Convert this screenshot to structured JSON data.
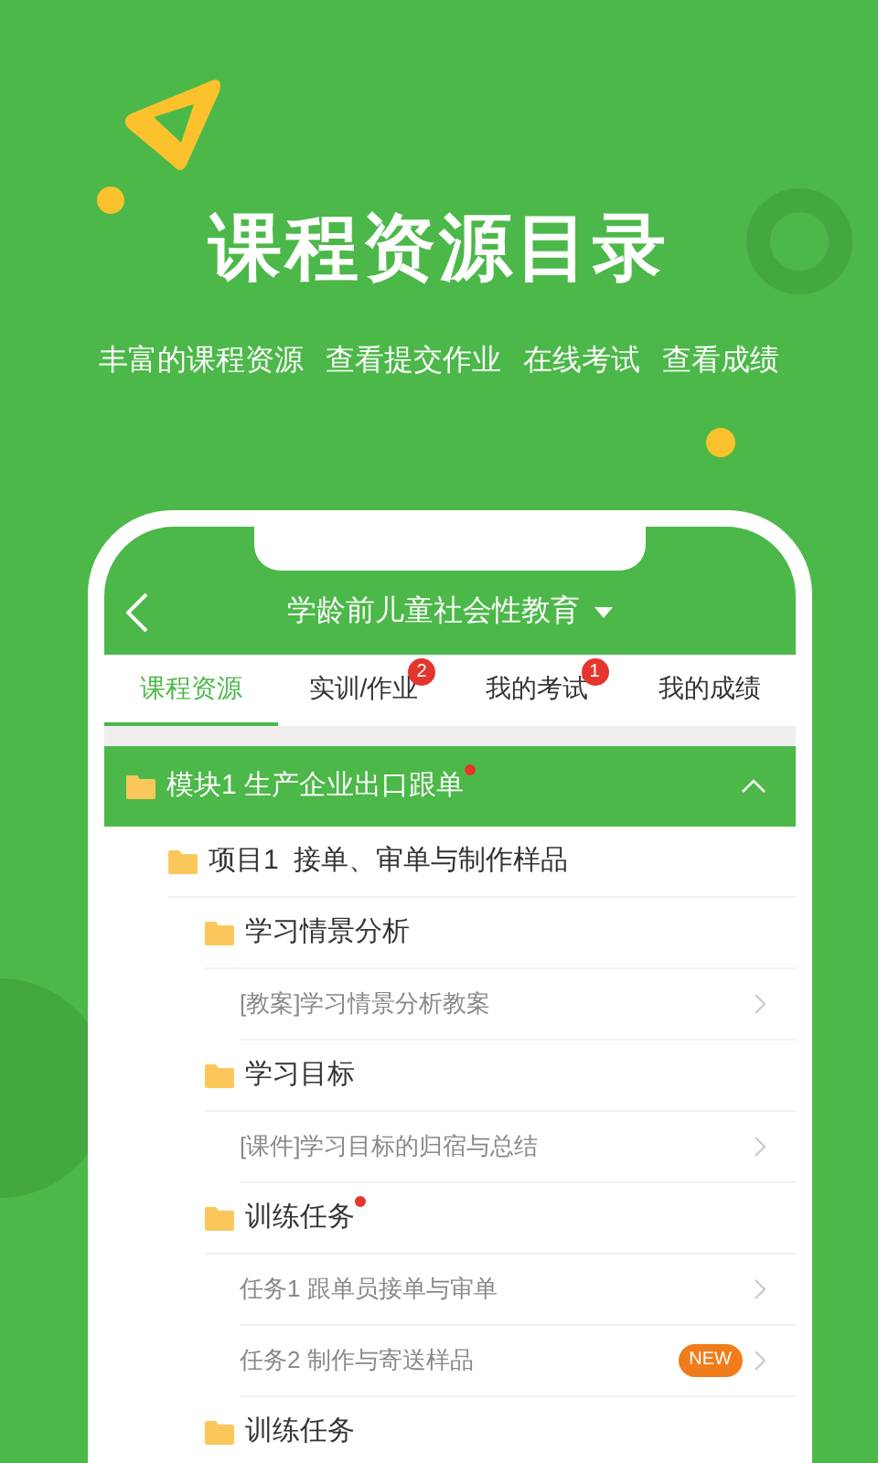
{
  "headline": "课程资源目录",
  "features": [
    "丰富的课程资源",
    "查看提交作业",
    "在线考试",
    "查看成绩"
  ],
  "app": {
    "title": "学龄前儿童社会性教育",
    "dropdown": true,
    "tabs": [
      {
        "label": "课程资源",
        "selected": true
      },
      {
        "label": "实训/作业",
        "selected": false,
        "badge": "2"
      },
      {
        "label": "我的考试",
        "selected": false,
        "badge": "1"
      },
      {
        "label": "我的成绩",
        "selected": false
      }
    ],
    "tree": [
      {
        "kind": "module",
        "label": "模块1 生产企业出口跟单",
        "dot": true,
        "expanded": true,
        "children": [
          {
            "kind": "folder",
            "label": "项目1  接单、审单与制作样品",
            "dot": false,
            "children": [
              {
                "kind": "folder",
                "label": "学习情景分析",
                "dot": false,
                "children": [
                  {
                    "kind": "file",
                    "label": "[教案]学习情景分析教案"
                  }
                ]
              },
              {
                "kind": "folder",
                "label": "学习目标",
                "dot": false,
                "children": [
                  {
                    "kind": "file",
                    "label": "[课件]学习目标的归宿与总结"
                  }
                ]
              },
              {
                "kind": "folder",
                "label": "训练任务",
                "dot": true,
                "children": [
                  {
                    "kind": "file",
                    "label": "任务1 跟单员接单与审单"
                  },
                  {
                    "kind": "file",
                    "label": "任务2 制作与寄送样品",
                    "badge": "NEW"
                  }
                ]
              },
              {
                "kind": "folder",
                "label": "训练任务",
                "dot": false
              }
            ]
          }
        ]
      }
    ]
  }
}
